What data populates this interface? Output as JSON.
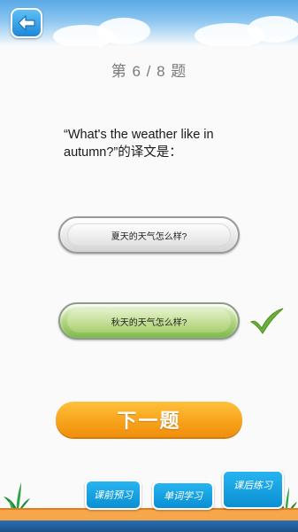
{
  "header": {
    "back_icon": "back-arrow-icon"
  },
  "progress": {
    "label": "第 6 / 8  题"
  },
  "question": {
    "text": "“What's the weather like in autumn?”的译文是："
  },
  "options": [
    {
      "label": "夏天的天气怎么样?",
      "selected": false
    },
    {
      "label": "秋天的天气怎么样?",
      "selected": true,
      "correct": true
    }
  ],
  "next_button": {
    "label": "下一题"
  },
  "tabs": [
    {
      "label": "课前预习"
    },
    {
      "label": "单词学习"
    },
    {
      "label": "课后练习",
      "active": true
    }
  ],
  "colors": {
    "accent_blue": "#1e88d8",
    "next_orange": "#f7a11a",
    "correct_green": "#6ab03a"
  }
}
